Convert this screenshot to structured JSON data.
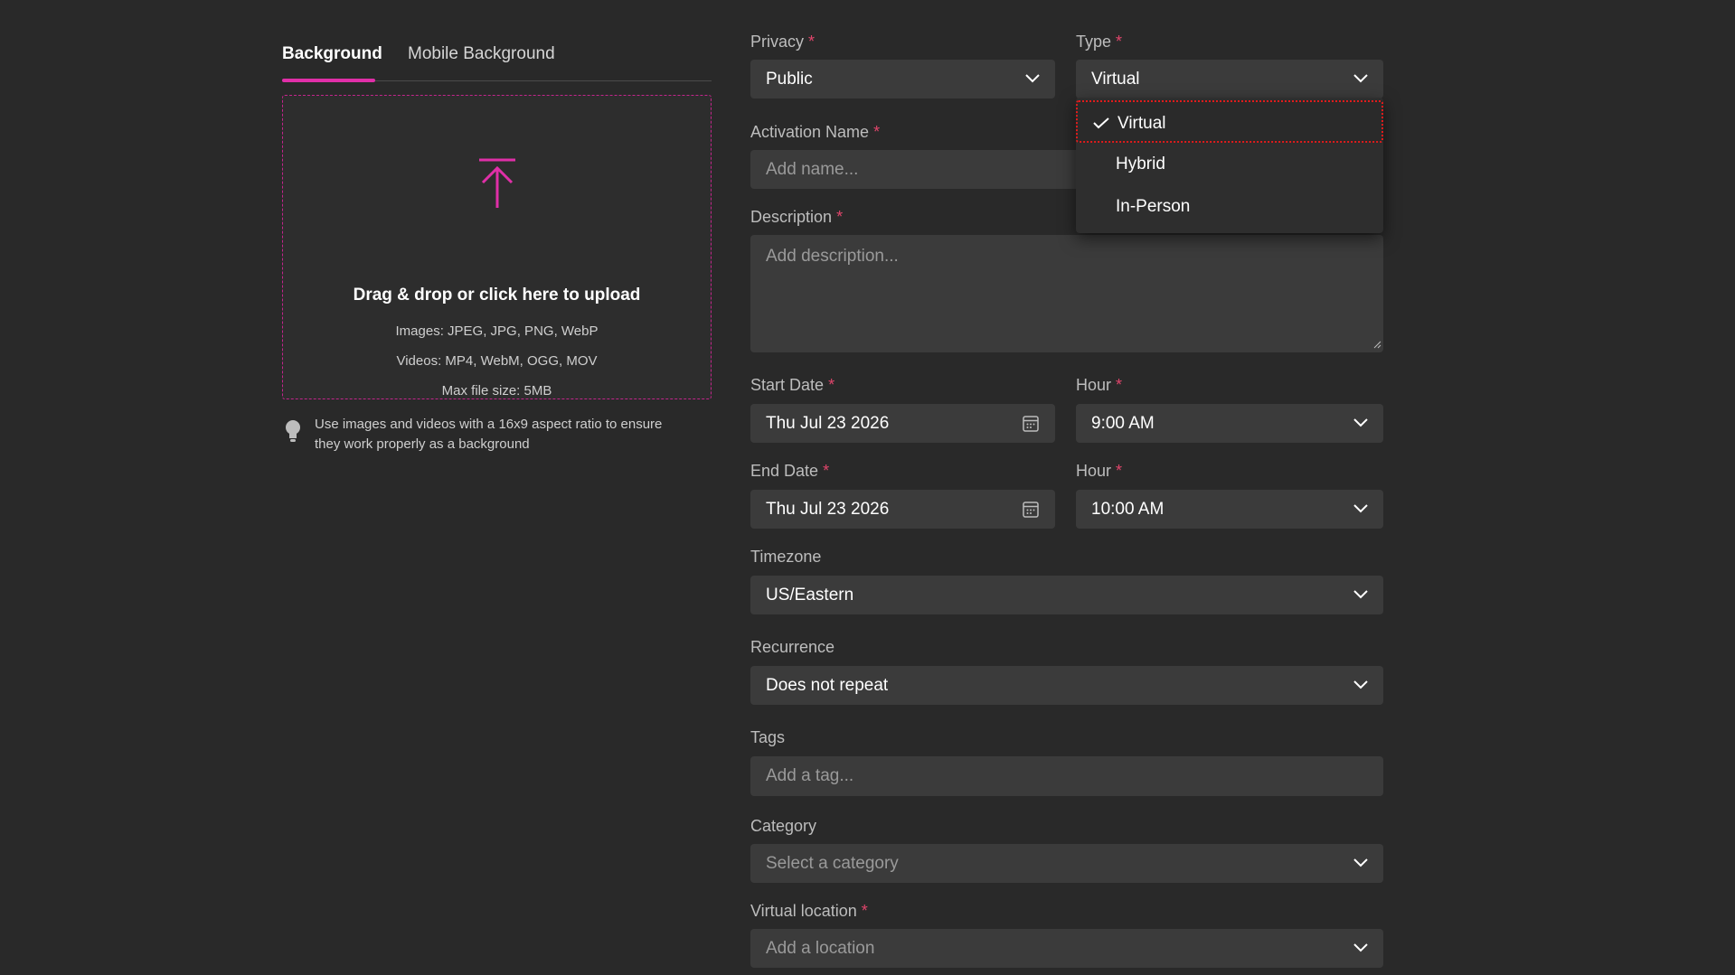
{
  "tabs": [
    {
      "label": "Background",
      "active": true
    },
    {
      "label": "Mobile Background",
      "active": false
    }
  ],
  "upload": {
    "title": "Drag & drop or click here to upload",
    "images": "Images: JPEG, JPG, PNG, WebP",
    "videos": "Videos: MP4, WebM, OGG, MOV",
    "max_size": "Max file size: 5MB"
  },
  "hint": {
    "line1": "Use images and videos with a 16x9 aspect ratio to ensure",
    "line2": "they work properly as a background"
  },
  "form": {
    "privacy": {
      "label": "Privacy",
      "value": "Public"
    },
    "type": {
      "label": "Type",
      "value": "Virtual",
      "options": [
        "Virtual",
        "Hybrid",
        "In-Person"
      ]
    },
    "activation_name": {
      "label": "Activation Name",
      "placeholder": "Add name..."
    },
    "description": {
      "label": "Description",
      "placeholder": "Add description..."
    },
    "start_date": {
      "label": "Start Date",
      "value": "Thu Jul 23 2026"
    },
    "start_hour": {
      "label": "Hour",
      "value": "9:00 AM"
    },
    "end_date": {
      "label": "End Date",
      "value": "Thu Jul 23 2026"
    },
    "end_hour": {
      "label": "Hour",
      "value": "10:00 AM"
    },
    "timezone": {
      "label": "Timezone",
      "value": "US/Eastern"
    },
    "recurrence": {
      "label": "Recurrence",
      "value": "Does not repeat"
    },
    "tags": {
      "label": "Tags",
      "placeholder": "Add a tag..."
    },
    "category": {
      "label": "Category",
      "placeholder": "Select a category"
    },
    "virtual_location": {
      "label": "Virtual location",
      "placeholder": "Add a location"
    },
    "required_mark": "*"
  },
  "colors": {
    "accent": "#e02fa8",
    "required": "#e0456b",
    "background": "#292929",
    "field": "#3b3b3b",
    "focus_outline": "#e21b1b"
  },
  "icons": [
    "upload-arrow-icon",
    "lightbulb-icon",
    "chevron-down-icon",
    "calendar-icon",
    "checkmark-icon"
  ]
}
